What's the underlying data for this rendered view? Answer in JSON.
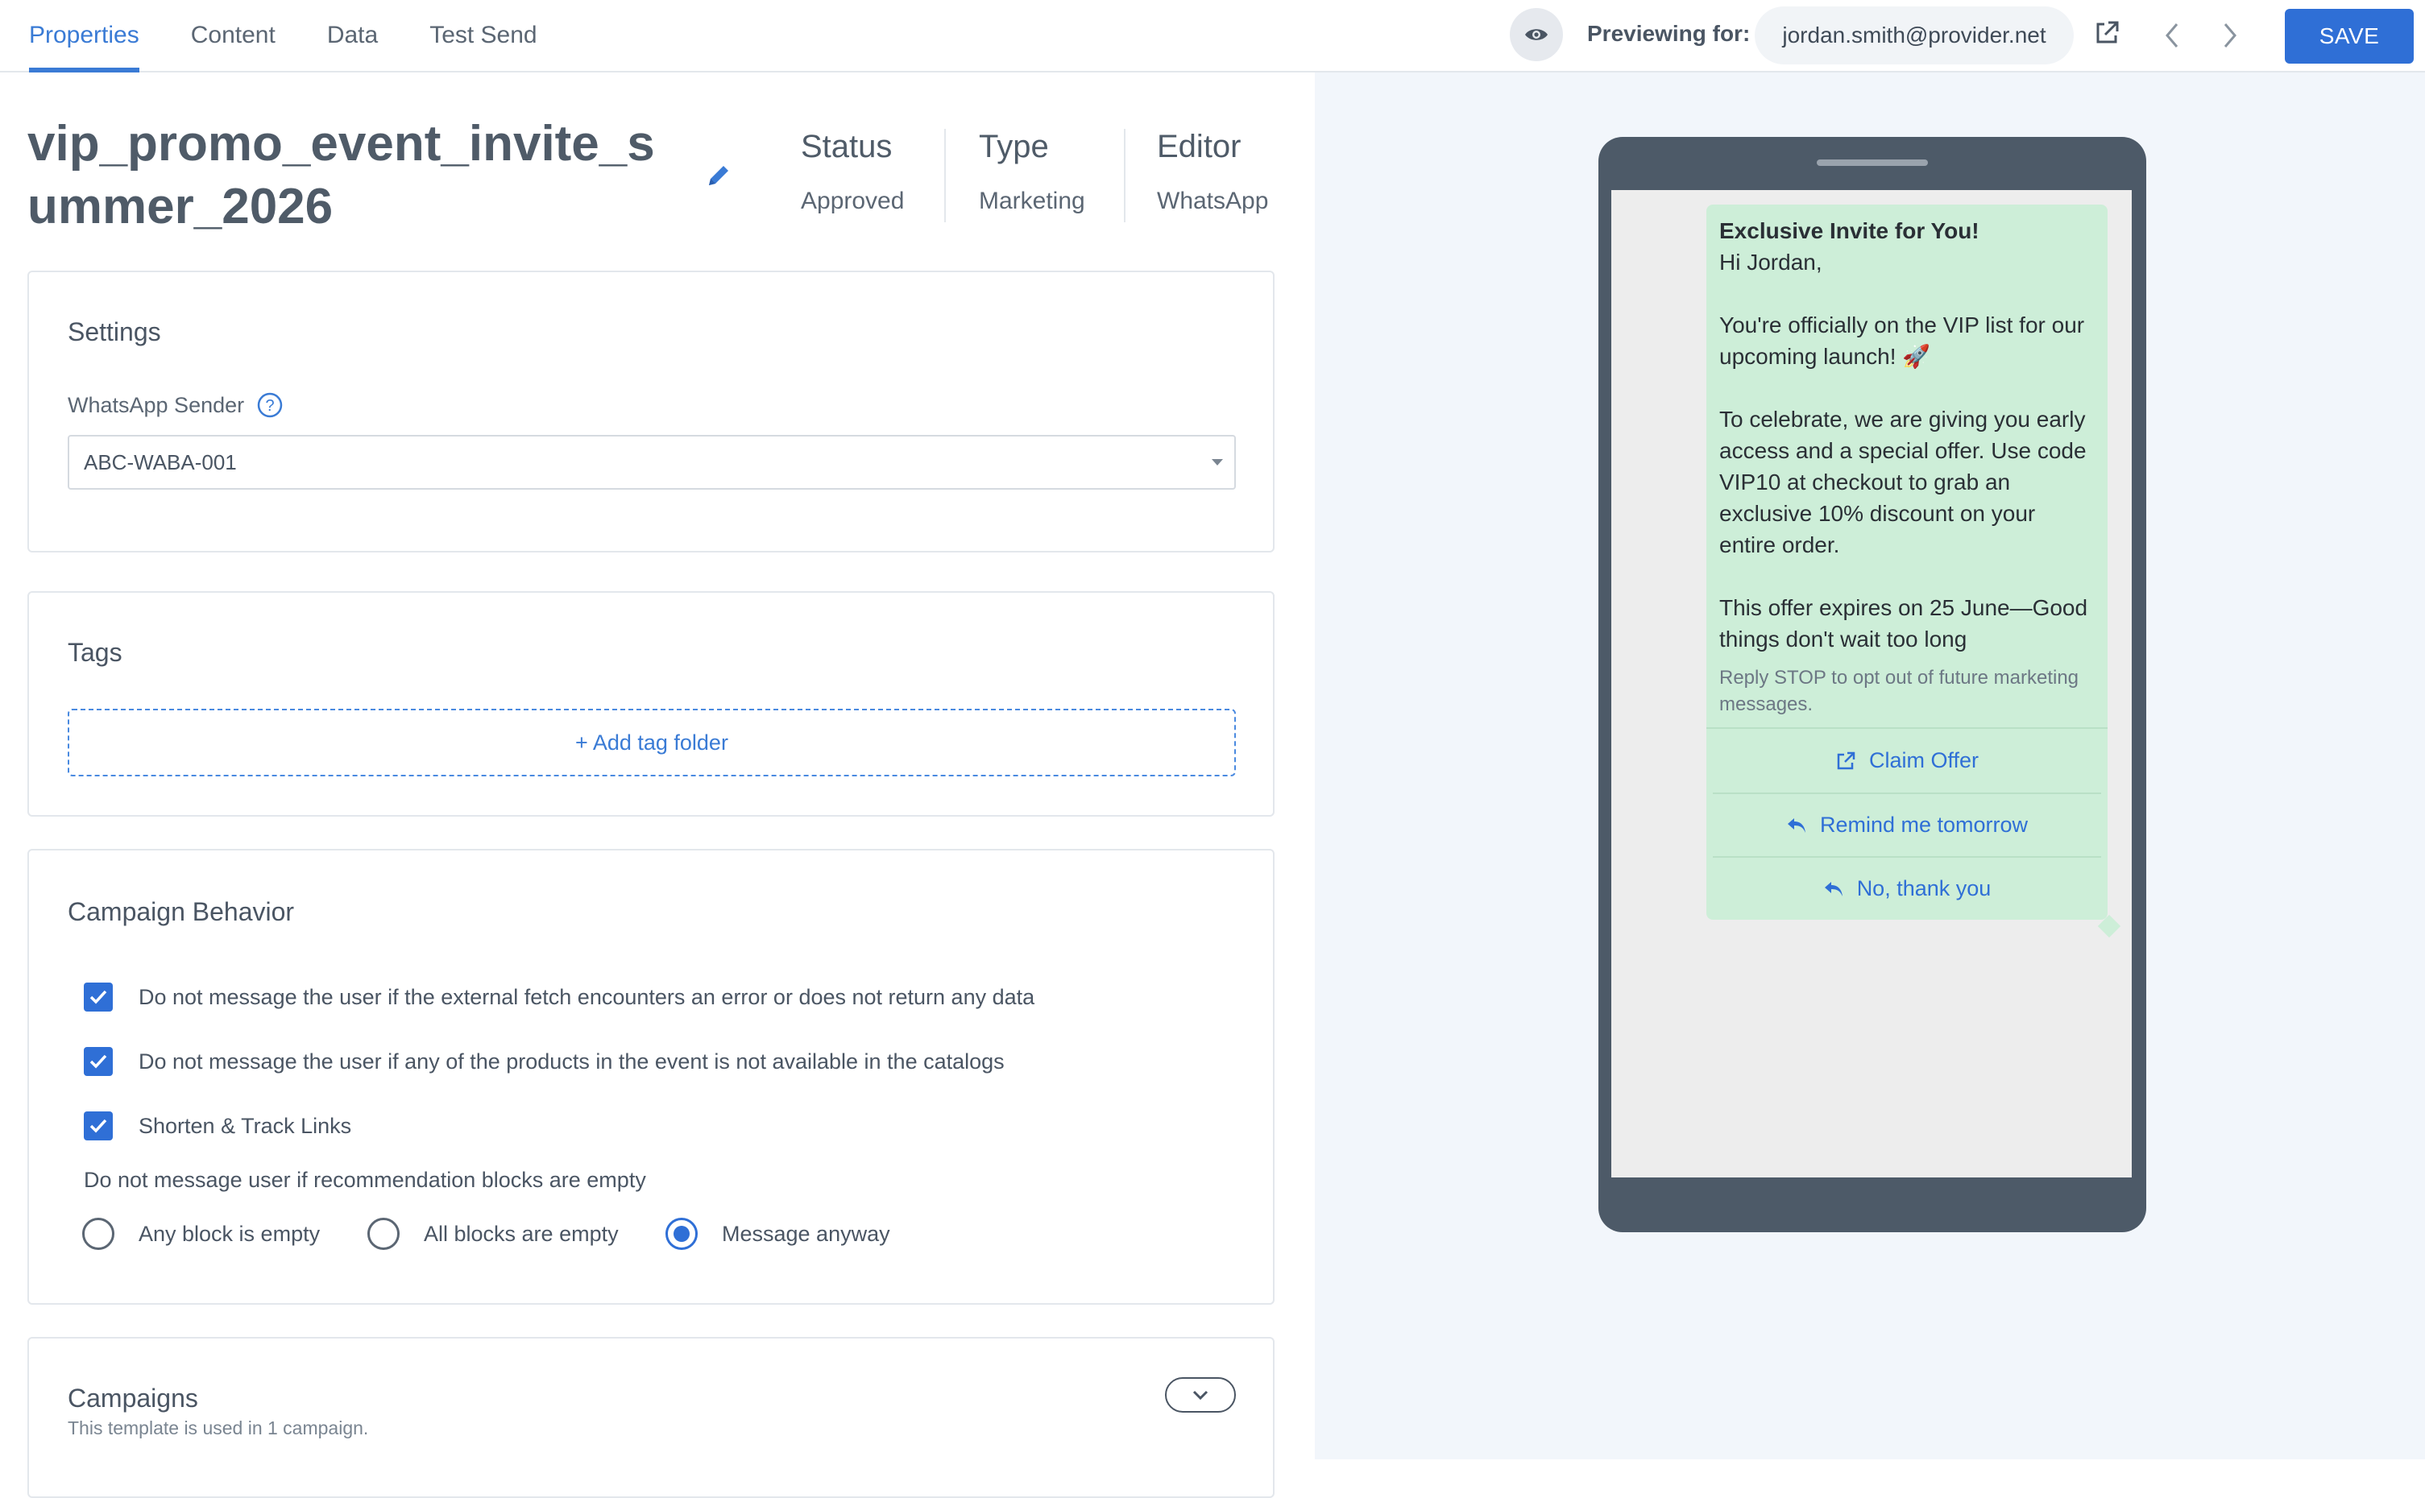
{
  "tabs": [
    {
      "label": "Properties",
      "active": true
    },
    {
      "label": "Content",
      "active": false
    },
    {
      "label": "Data",
      "active": false
    },
    {
      "label": "Test Send",
      "active": false
    }
  ],
  "header": {
    "previewing_label": "Previewing for:",
    "preview_email": "jordan.smith@provider.net",
    "save_label": "SAVE",
    "icons": [
      "eye-icon",
      "external-link-icon",
      "chevron-left-icon",
      "chevron-right-icon"
    ]
  },
  "template": {
    "name": "vip_promo_event_invite_summer_2026",
    "meta": [
      {
        "key": "Status",
        "value": "Approved"
      },
      {
        "key": "Type",
        "value": "Marketing"
      },
      {
        "key": "Editor",
        "value": "WhatsApp"
      }
    ]
  },
  "settings": {
    "title": "Settings",
    "sender_label": "WhatsApp Sender",
    "sender_value": "ABC-WABA-001"
  },
  "tags": {
    "title": "Tags",
    "add_label": "+ Add tag folder"
  },
  "behavior": {
    "title": "Campaign Behavior",
    "checks": [
      {
        "label": "Do not message the user if the external fetch encounters an error or does not return any data",
        "checked": true
      },
      {
        "label": "Do not message the user if any of the products in the event is not available in the catalogs",
        "checked": true
      },
      {
        "label": "Shorten & Track Links",
        "checked": true
      }
    ],
    "empty_label": "Do not message user if recommendation blocks are empty",
    "radios": [
      {
        "label": "Any block is empty",
        "selected": false
      },
      {
        "label": "All blocks are empty",
        "selected": false
      },
      {
        "label": "Message anyway",
        "selected": true
      }
    ]
  },
  "campaigns": {
    "title": "Campaigns",
    "subtitle": "This template is used in 1 campaign."
  },
  "preview": {
    "title": "Exclusive Invite for You!",
    "body": "Hi Jordan,\n\nYou're officially on the VIP list for our upcoming launch! 🚀\n\nTo celebrate, we are giving you early access and a special offer. Use code VIP10 at checkout to grab an exclusive 10% discount on your entire order.\n\nThis offer expires on 25 June—Good things don't wait too long",
    "footer": "Reply STOP to opt out of future marketing messages.",
    "buttons": [
      {
        "label": "Claim Offer",
        "icon": "external-link-icon"
      },
      {
        "label": "Remind me tomorrow",
        "icon": "reply-icon"
      },
      {
        "label": "No, thank you",
        "icon": "reply-icon"
      }
    ]
  },
  "colors": {
    "accent": "#2f6fd6",
    "bubble": "#cdeed8",
    "phone": "#4d5a68",
    "preview_bg": "#f2f6fb"
  }
}
